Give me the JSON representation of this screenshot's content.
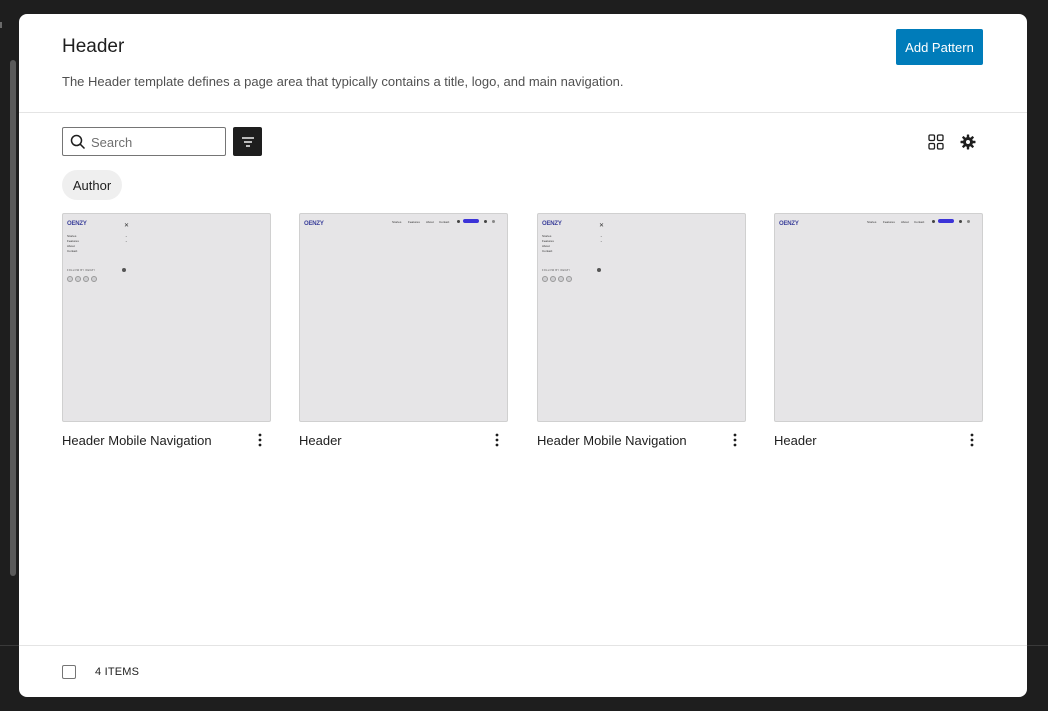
{
  "modal": {
    "title": "Header",
    "description": "The Header template defines a page area that typically contains a title, logo, and main navigation.",
    "add_button": "Add Pattern"
  },
  "toolbar": {
    "search_placeholder": "Search",
    "filter_icon": "filter-icon",
    "grid_icon": "grid-view-icon",
    "settings_icon": "gear-icon"
  },
  "filters": {
    "chip": "Author"
  },
  "patterns": [
    {
      "title": "Header Mobile Navigation"
    },
    {
      "title": "Header"
    },
    {
      "title": "Header Mobile Navigation"
    },
    {
      "title": "Header"
    }
  ],
  "preview": {
    "logo": "OENZY",
    "mobile_menu": [
      "Stories",
      "Features",
      "About",
      "Contact"
    ],
    "follow_text": "FOLLOW BY OENZY",
    "desktop_nav": [
      "Stories",
      "Features",
      "About",
      "Contact"
    ],
    "subscribe": "Subscribe"
  },
  "footer": {
    "count": "4 ITEMS"
  },
  "colors": {
    "accent": "#007cba",
    "preview_bg": "#e6e5e7",
    "preview_accent": "#3c33d8"
  }
}
